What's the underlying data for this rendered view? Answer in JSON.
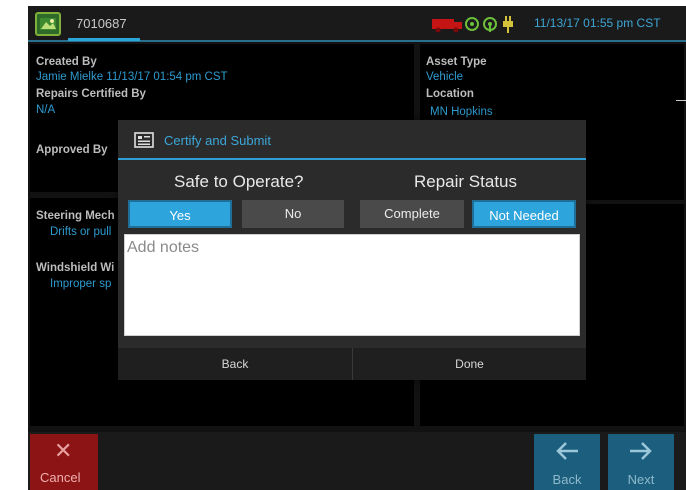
{
  "topbar": {
    "unit_id": "7010687",
    "datetime": "11/13/17 01:55 pm CST",
    "icons": [
      "truck-icon",
      "gps-icon",
      "signal-icon",
      "plug-icon"
    ]
  },
  "details": {
    "created_by_label": "Created By",
    "created_by_value": "Jamie Mielke 11/13/17 01:54 pm CST",
    "repairs_certified_label": "Repairs Certified By",
    "repairs_certified_value": "N/A",
    "approved_by_label": "Approved By",
    "asset_type_label": "Asset Type",
    "asset_type_value": "Vehicle",
    "location_label": "Location",
    "location_value": "MN Hopkins"
  },
  "defects": [
    {
      "label": "Steering Mech",
      "value": "Drifts or pull"
    },
    {
      "label": "Windshield Wi",
      "value": "Improper sp"
    }
  ],
  "dialog": {
    "title": "Certify and Submit",
    "safe_question": "Safe to Operate?",
    "repair_question": "Repair Status",
    "safe_options": [
      "Yes",
      "No"
    ],
    "safe_selected": "Yes",
    "repair_options": [
      "Complete",
      "Not Needed"
    ],
    "repair_selected": "Not Needed",
    "notes_placeholder": "Add notes",
    "notes_value": "",
    "back_label": "Back",
    "done_label": "Done"
  },
  "bottombar": {
    "cancel_label": "Cancel",
    "back_label": "Back",
    "next_label": "Next"
  },
  "colors": {
    "accent": "#2ea4dc",
    "cancel": "#8c1414",
    "nav": "#1b5e7d",
    "status_truck": "#c41414"
  }
}
